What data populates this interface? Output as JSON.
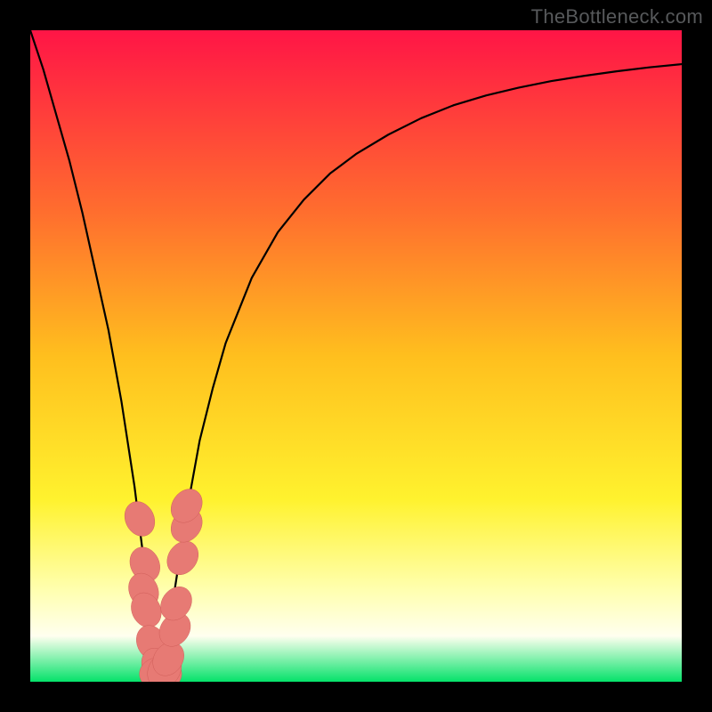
{
  "watermark": "TheBottleneck.com",
  "colors": {
    "frame": "#000000",
    "gradient_top": "#ff1546",
    "gradient_upper_mid": "#ff6e2e",
    "gradient_mid": "#ffbf1e",
    "gradient_lower_mid": "#fff22e",
    "gradient_pale": "#ffffb0",
    "gradient_bottom": "#05e26a",
    "curve": "#000000",
    "marker_fill": "#e77a74",
    "marker_stroke": "#cc5a55"
  },
  "chart_data": {
    "type": "line",
    "title": "",
    "xlabel": "",
    "ylabel": "",
    "xlim": [
      0,
      100
    ],
    "ylim": [
      0,
      100
    ],
    "x": [
      0,
      2,
      4,
      6,
      8,
      10,
      12,
      14,
      16,
      17,
      18,
      19,
      19.5,
      20,
      20.5,
      21,
      22,
      24,
      26,
      28,
      30,
      34,
      38,
      42,
      46,
      50,
      55,
      60,
      65,
      70,
      75,
      80,
      85,
      90,
      95,
      100
    ],
    "y": [
      100,
      94,
      87,
      80,
      72,
      63,
      54,
      43,
      30,
      22,
      14,
      6,
      3,
      1,
      3,
      6,
      13,
      26,
      37,
      45,
      52,
      62,
      69,
      74,
      78,
      81,
      84,
      86.5,
      88.5,
      90,
      91.2,
      92.2,
      93,
      93.7,
      94.3,
      94.8
    ],
    "markers": [
      {
        "x": 16.8,
        "y": 25,
        "r": 2.2
      },
      {
        "x": 17.6,
        "y": 18,
        "r": 2.2
      },
      {
        "x": 17.4,
        "y": 14,
        "r": 2.2
      },
      {
        "x": 17.8,
        "y": 11,
        "r": 2.2
      },
      {
        "x": 18.6,
        "y": 6,
        "r": 2.2
      },
      {
        "x": 19.4,
        "y": 2.5,
        "r": 2.2
      },
      {
        "x": 20.0,
        "y": 1.2,
        "r": 2.6
      },
      {
        "x": 20.6,
        "y": 1.8,
        "r": 2.4
      },
      {
        "x": 21.2,
        "y": 3.5,
        "r": 2.2
      },
      {
        "x": 22.2,
        "y": 8,
        "r": 2.2
      },
      {
        "x": 22.4,
        "y": 12,
        "r": 2.2
      },
      {
        "x": 23.4,
        "y": 19,
        "r": 2.2
      },
      {
        "x": 24.0,
        "y": 24,
        "r": 2.2
      },
      {
        "x": 24.0,
        "y": 27,
        "r": 2.2
      }
    ]
  }
}
